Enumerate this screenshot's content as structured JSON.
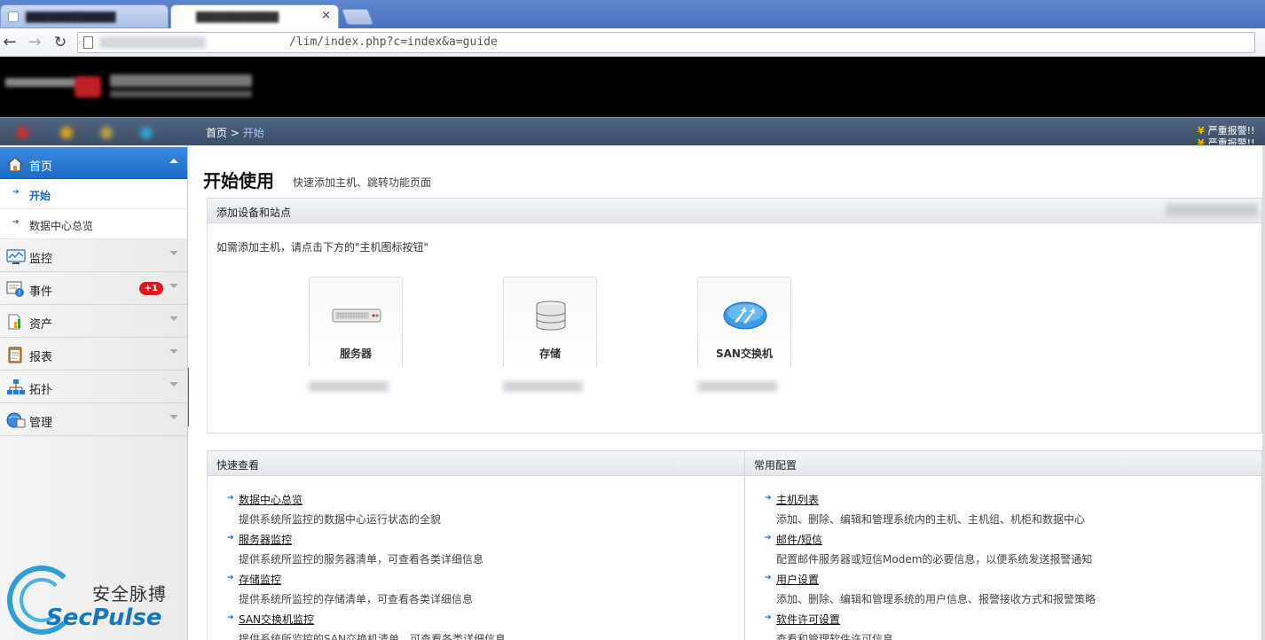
{
  "browser": {
    "address_path": "/lim/index.php?c=index&a=guide",
    "tab_close": "×"
  },
  "breadcrumb": {
    "home": "首页",
    "separator": " > ",
    "current": "开始"
  },
  "alarm": {
    "line1": "严重报警!!",
    "line2": "严重报警!!"
  },
  "sidebar": {
    "home": "首页",
    "home_subitems": [
      "开始",
      "数据中心总览"
    ],
    "monitor": "监控",
    "events": "事件",
    "events_badge": "+1",
    "assets": "资产",
    "reports": "报表",
    "topology": "拓扑",
    "manage": "管理"
  },
  "main": {
    "title": "开始使用",
    "subtitle": "快速添加主机、跳转功能页面",
    "add_panel": {
      "title": "添加设备和站点",
      "hint": "如需添加主机，请点击下方的\"主机图标按钮\"",
      "devices": [
        "服务器",
        "存储",
        "SAN交换机"
      ]
    },
    "quick_panel": {
      "title": "快速查看",
      "links": [
        {
          "title": "数据中心总览",
          "desc": "提供系统所监控的数据中心运行状态的全貌"
        },
        {
          "title": "服务器监控",
          "desc": "提供系统所监控的服务器清单，可查看各类详细信息"
        },
        {
          "title": "存储监控",
          "desc": "提供系统所监控的存储清单，可查看各类详细信息"
        },
        {
          "title": "SAN交换机监控",
          "desc": "提供系统所监控的SAN交换机清单，可查看各类详细信息"
        }
      ]
    },
    "config_panel": {
      "title": "常用配置",
      "links": [
        {
          "title": "主机列表",
          "desc": "添加、删除、编辑和管理系统内的主机、主机组、机柜和数据中心"
        },
        {
          "title": "邮件/短信",
          "desc": "配置邮件服务器或短信Modem的必要信息，以便系统发送报警通知"
        },
        {
          "title": "用户设置",
          "desc": "添加、删除、编辑和管理系统的用户信息、报警接收方式和报警策略"
        },
        {
          "title": "软件许可设置",
          "desc": "查看和管理软件许可信息"
        }
      ]
    }
  },
  "watermark": {
    "cn": "安全脉搏",
    "en": "SecPulse"
  },
  "colors": {
    "accent_blue": "#1c6cc7",
    "header_black": "#000000",
    "badge_red": "#e4161c",
    "breadcrumb_current": "#9ecbff"
  }
}
